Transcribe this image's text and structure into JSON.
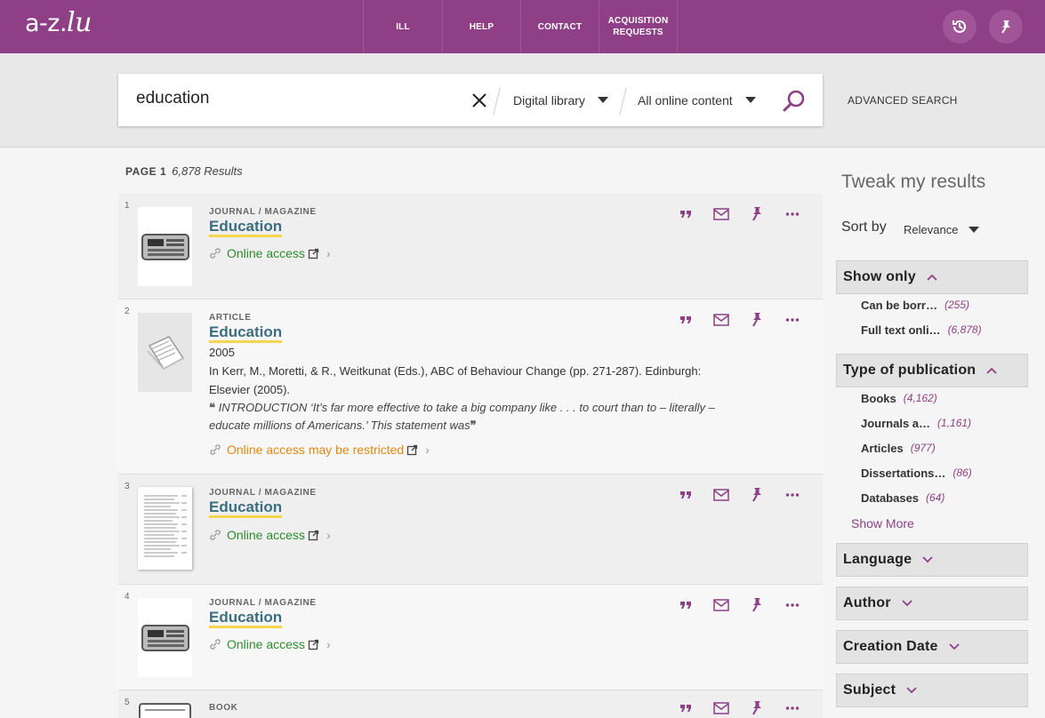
{
  "header": {
    "logo": {
      "main": "a-z.",
      "accent": "lu"
    },
    "nav": [
      {
        "label": "ILL"
      },
      {
        "label": "HELP"
      },
      {
        "label": "CONTACT"
      },
      {
        "label": "ACQUISITION REQUESTS"
      }
    ]
  },
  "search": {
    "query": "education",
    "scope": "Digital library",
    "content": "All online content",
    "advanced_label": "ADVANCED SEARCH"
  },
  "results_info": {
    "page": "PAGE 1",
    "count": "6,878 Results"
  },
  "results": [
    {
      "num": "1",
      "type": "JOURNAL / MAGAZINE",
      "title": "Education",
      "access": "Online access"
    },
    {
      "num": "2",
      "type": "ARTICLE",
      "title": "Education",
      "year": "2005",
      "citation_1": "In Kerr, M., Moretti, & R., Weitkunat (Eds.), ABC of Behaviour Change (pp. 271-287). Edinburgh:",
      "citation_2": "Elsevier (2005).",
      "snippet_1": "INTRODUCTION ‘It’s far more effective to take a big company like . . . to court than to – literally –",
      "snippet_2": "educate millions of Americans.’ This statement was",
      "access": "Online access may be restricted"
    },
    {
      "num": "3",
      "type": "JOURNAL / MAGAZINE",
      "title": "Education",
      "access": "Online access"
    },
    {
      "num": "4",
      "type": "JOURNAL / MAGAZINE",
      "title": "Education",
      "access": "Online access"
    },
    {
      "num": "5",
      "type": "BOOK"
    }
  ],
  "sidebar": {
    "title": "Tweak my results",
    "sort_label": "Sort by",
    "sort_value": "Relevance",
    "show_only": {
      "label": "Show only",
      "items": [
        {
          "label": "Can be borr…",
          "count": "(255)"
        },
        {
          "label": "Full text onli…",
          "count": "(6,878)"
        }
      ]
    },
    "type_of_publication": {
      "label": "Type of publication",
      "items": [
        {
          "label": "Books",
          "count": "(4,162)"
        },
        {
          "label": "Journals a…",
          "count": "(1,161)"
        },
        {
          "label": "Articles",
          "count": "(977)"
        },
        {
          "label": "Dissertations…",
          "count": "(86)"
        },
        {
          "label": "Databases",
          "count": "(64)"
        }
      ],
      "show_more": "Show More"
    },
    "facets": [
      {
        "label": "Language"
      },
      {
        "label": "Author"
      },
      {
        "label": "Creation Date"
      },
      {
        "label": "Subject"
      }
    ]
  },
  "colors": {
    "brand": "#8e3f86",
    "link": "#3b6e80",
    "highlight": "#f3d54e",
    "access_green": "#2e8b2e",
    "access_orange": "#e08a12"
  }
}
